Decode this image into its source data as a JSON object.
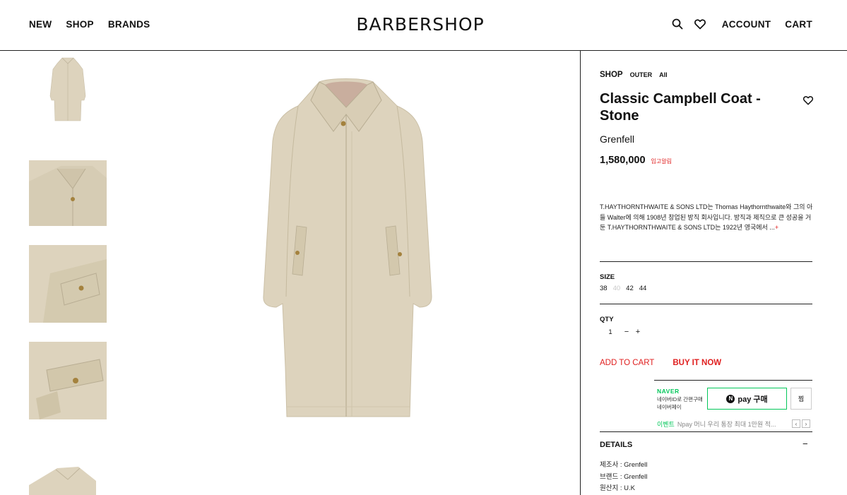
{
  "header": {
    "nav_left": [
      "NEW",
      "SHOP",
      "BRANDS"
    ],
    "logo": "BARBERSHOP",
    "account": "ACCOUNT",
    "cart": "CART"
  },
  "breadcrumb": {
    "section": "SHOP",
    "category": "OUTER",
    "sub": "All"
  },
  "product": {
    "title": "Classic Campbell Coat - Stone",
    "brand": "Grenfell",
    "price": "1,580,000",
    "restock_label": "입고알림",
    "description": "T.HAYTHORNTHWAITE & SONS LTD는 Thomas Haythornthwaite와 그의 아들 Walter에 의해 1908년 창업된 방직 회사입니다. 방직과 제직으로 큰 성공을 거둔 T.HAYTHORNTHWAITE & SONS LTD는 1922년 영국에서 ...",
    "more": "+",
    "color_hex": "#ddd3bd"
  },
  "size": {
    "label": "SIZE",
    "options": [
      {
        "value": "38",
        "available": true
      },
      {
        "value": "40",
        "available": false
      },
      {
        "value": "42",
        "available": true
      },
      {
        "value": "44",
        "available": true
      }
    ]
  },
  "qty": {
    "label": "QTY",
    "value": "1",
    "minus": "−",
    "plus": "+"
  },
  "actions": {
    "add_to_cart": "ADD TO CART",
    "buy_now": "BUY IT NOW",
    "accent": "#e02020"
  },
  "naver_pay": {
    "brand": "NAVER",
    "sub": "네이버ID로 간편구매 네이버페이",
    "button": "pay 구매",
    "n_mark": "N",
    "zzim": "찜",
    "event_tag": "이벤트",
    "event_text": "Npay 머니 우리 통장 최대 1만원 적...",
    "prev": "‹",
    "next": "›",
    "accent": "#03c75a"
  },
  "details": {
    "title": "DETAILS",
    "toggle": "−",
    "rows": [
      "제조사 : Grenfell",
      "브랜드 : Grenfell",
      "원산지 : U.K"
    ]
  }
}
